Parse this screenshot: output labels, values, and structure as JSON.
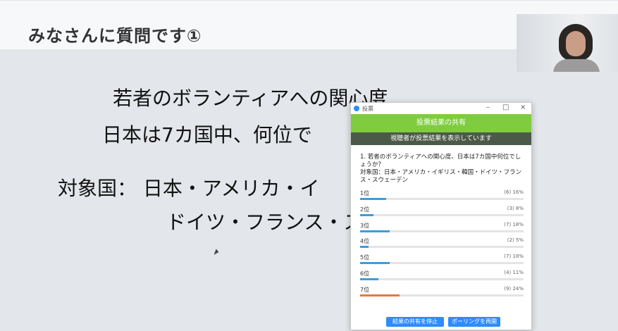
{
  "slide": {
    "title": "みなさんに質問です①",
    "line1": "若者のボランティアへの関心度",
    "line2": "日本は7カ国中、何位で",
    "line3": "対象国： 日本・アメリカ・イ",
    "line4": "ドイツ・フランス・ス"
  },
  "poll": {
    "window_title": "投票",
    "header": "投票結果の共有",
    "banner": "視聴者が投票結果を表示しています",
    "question": "1. 若者のボランティアへの関心度、日本は7カ国中何位でしょうか？\n対象国：日本・アメリカ・イギリス・韓国・ドイツ・フランス・スウェーデン",
    "results": [
      {
        "label": "1位",
        "count_text": "(6) 16%",
        "percent": 16
      },
      {
        "label": "2位",
        "count_text": "(3) 8%",
        "percent": 8
      },
      {
        "label": "3位",
        "count_text": "(7) 18%",
        "percent": 18
      },
      {
        "label": "4位",
        "count_text": "(2) 5%",
        "percent": 5
      },
      {
        "label": "5位",
        "count_text": "(7) 18%",
        "percent": 18
      },
      {
        "label": "6位",
        "count_text": "(4) 11%",
        "percent": 11
      },
      {
        "label": "7位",
        "count_text": "(9) 24%",
        "percent": 24,
        "highlight": true
      }
    ],
    "buttons": {
      "stop_share": "結果の共有を停止",
      "restart": "ポーリングを再開"
    },
    "colors": {
      "header": "#7fcd3f",
      "bar": "#3d9ddc",
      "bar_highlight": "#e07a3a",
      "button": "#2d8cff"
    }
  }
}
